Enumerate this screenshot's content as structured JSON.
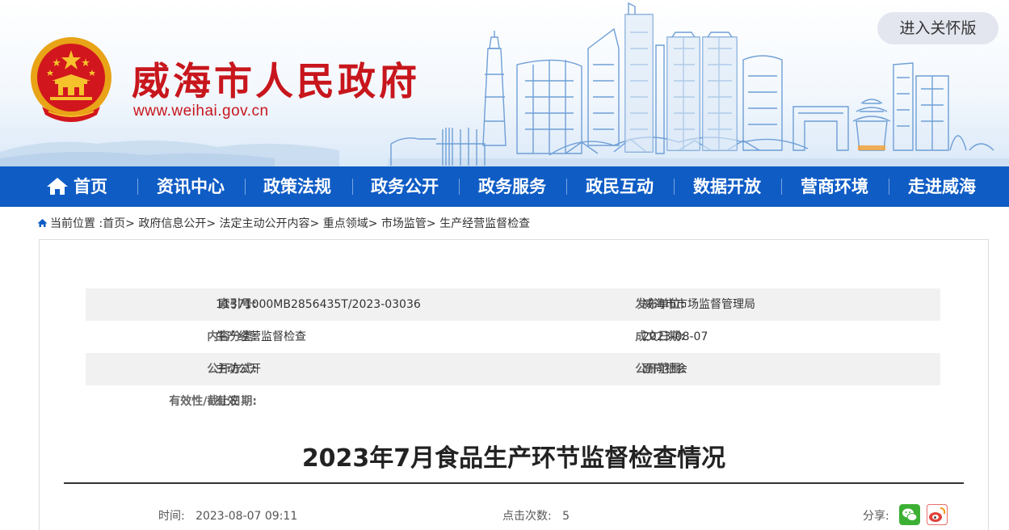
{
  "header": {
    "site_title": "威海市人民政府",
    "site_url": "www.weihai.gov.cn",
    "care_mode_button": "进入关怀版",
    "brand_color": "#c8161d"
  },
  "nav": {
    "background": "#0f5cc5",
    "items": [
      {
        "label": "首页",
        "icon": "home-icon"
      },
      {
        "label": "资讯中心"
      },
      {
        "label": "政策法规"
      },
      {
        "label": "政务公开"
      },
      {
        "label": "政务服务"
      },
      {
        "label": "政民互动"
      },
      {
        "label": "数据开放"
      },
      {
        "label": "营商环境"
      },
      {
        "label": "走进威海"
      }
    ]
  },
  "breadcrumb": {
    "prefix": "当前位置 :",
    "items": [
      "首页",
      "政府信息公开",
      "法定主动公开内容",
      "重点领域",
      "市场监管",
      "生产经营监督检查"
    ],
    "separator": ">"
  },
  "meta": {
    "rows": [
      {
        "label1": "索引号:",
        "value1": "11371000MB2856435T/2023-03036",
        "label2": "发布单位:",
        "value2": "威海市市场监督管理局"
      },
      {
        "label1": "内容分类:",
        "value1": "生产经营监督检查",
        "label2": "成文日期:",
        "value2": "2023-08-07"
      },
      {
        "label1": "公开方式:",
        "value1": "主动公开",
        "label2": "公开范围:",
        "value2": "面向社会"
      },
      {
        "label1": "有效性/截止日期:",
        "value1": "有效"
      }
    ]
  },
  "article": {
    "title": "2023年7月食品生产环节监督检查情况",
    "time_label": "时间:",
    "time_value": "2023-08-07 09:11",
    "clicks_label": "点击次数:",
    "clicks_value": "5",
    "share_label": "分享:",
    "share_icons": [
      "wechat-icon",
      "weibo-icon"
    ]
  }
}
